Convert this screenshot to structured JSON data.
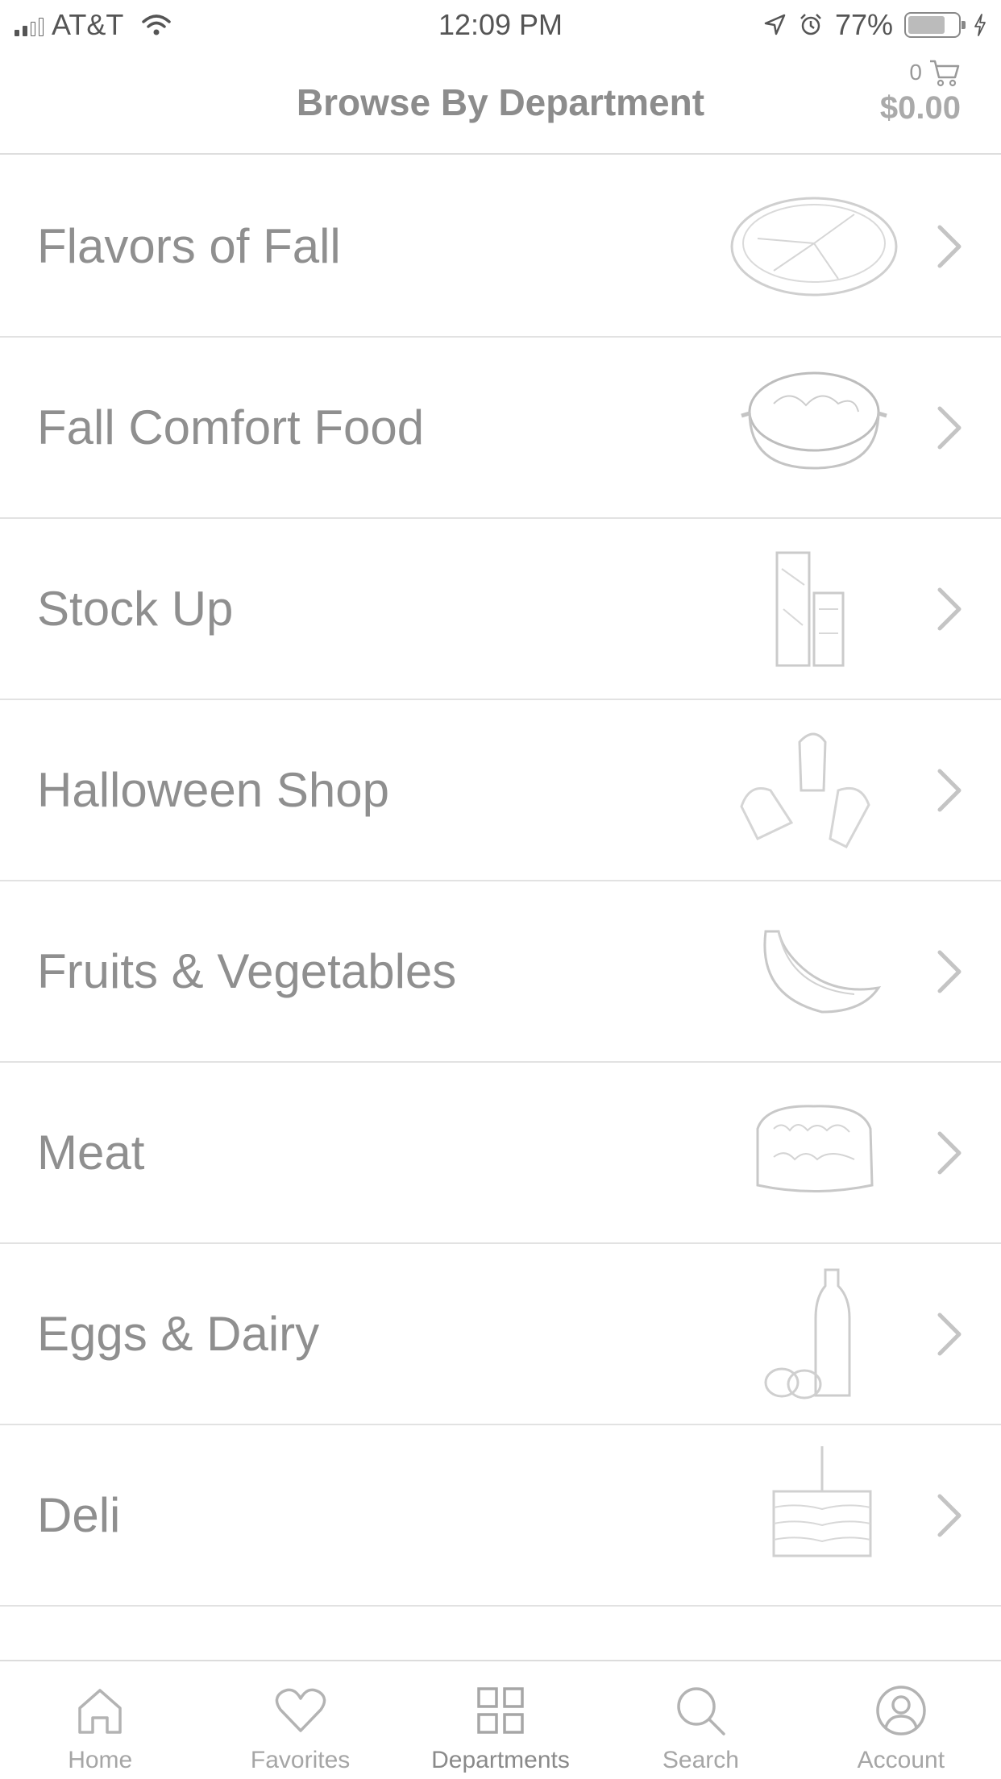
{
  "status_bar": {
    "carrier": "AT&T",
    "time": "12:09 PM",
    "battery_percent": "77%",
    "battery_level": 0.77,
    "icons": [
      "signal-icon",
      "wifi-icon",
      "location-icon",
      "alarm-icon",
      "battery-icon",
      "charging-icon"
    ]
  },
  "header": {
    "title": "Browse By Department",
    "cart_count": "0",
    "cart_total": "$0.00"
  },
  "departments": [
    {
      "label": "Flavors of Fall",
      "image": "pie-image"
    },
    {
      "label": "Fall Comfort Food",
      "image": "casserole-image"
    },
    {
      "label": "Stock Up",
      "image": "boxes-image"
    },
    {
      "label": "Halloween Shop",
      "image": "candy-corn-image"
    },
    {
      "label": "Fruits & Vegetables",
      "image": "bananas-image"
    },
    {
      "label": "Meat",
      "image": "ground-meat-image"
    },
    {
      "label": "Eggs & Dairy",
      "image": "milk-eggs-image"
    },
    {
      "label": "Deli",
      "image": "sandwich-image"
    }
  ],
  "tabs": [
    {
      "label": "Home",
      "icon": "home-icon",
      "active": false
    },
    {
      "label": "Favorites",
      "icon": "heart-icon",
      "active": false
    },
    {
      "label": "Departments",
      "icon": "grid-icon",
      "active": true
    },
    {
      "label": "Search",
      "icon": "search-icon",
      "active": false
    },
    {
      "label": "Account",
      "icon": "account-icon",
      "active": false
    }
  ]
}
